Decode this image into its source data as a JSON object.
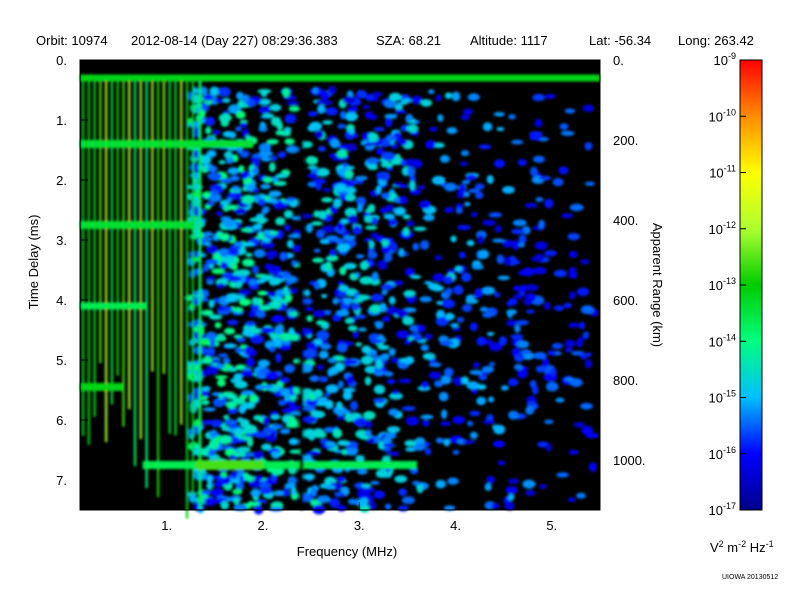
{
  "header": {
    "orbit": "Orbit: 10974",
    "datetime": "2012-08-14 (Day 227) 08:29:36.383",
    "sza": "SZA:  68.21",
    "altitude": "Altitude:     1117",
    "lat": "Lat: -56.34",
    "long": "Long: 263.42"
  },
  "credit": "UIOWA 20130512",
  "chart_data": {
    "type": "heatmap",
    "x": {
      "label": "Frequency (MHz)",
      "range": [
        0.1,
        5.5
      ],
      "ticks": [
        1,
        2,
        3,
        4,
        5
      ],
      "tick_labels": [
        "1.",
        "2.",
        "3.",
        "4.",
        "5."
      ]
    },
    "y_left": {
      "label": "Time Delay (ms)",
      "range": [
        0,
        7.5
      ],
      "inverted": true,
      "ticks": [
        0,
        1,
        2,
        3,
        4,
        5,
        6,
        7
      ],
      "tick_labels": [
        "0.",
        "1.",
        "2.",
        "3.",
        "4.",
        "5.",
        "6.",
        "7."
      ]
    },
    "y_right": {
      "label": "Apparent Range (km)",
      "range": [
        0,
        1125
      ],
      "ticks": [
        0,
        200,
        400,
        600,
        800,
        1000
      ],
      "tick_labels": [
        "0.",
        "200.",
        "400.",
        "600.",
        "800.",
        "1000."
      ]
    },
    "colorbar": {
      "scale": "log",
      "range_exponents": [
        -17,
        -9
      ],
      "exponents": [
        "-9",
        "-10",
        "-11",
        "-12",
        "-13",
        "-14",
        "-15",
        "-16",
        "-17"
      ],
      "tick_base": "10",
      "unit": {
        "v": "V",
        "v_exp": "2",
        "m": " m",
        "m_exp": "-2",
        "hz": " Hz",
        "hz_exp": "-1"
      },
      "colors": [
        "#00008b",
        "#0000ff",
        "#00bfff",
        "#00ff7f",
        "#00cc00",
        "#adff2f",
        "#ffff00",
        "#ff8c00",
        "#ff0000"
      ]
    },
    "features": [
      {
        "name": "surface-echo",
        "delay_ms": 6.75,
        "freq_mhz": [
          0.75,
          3.6
        ]
      },
      {
        "name": "local-plasma-line",
        "delay_ms": 0.3,
        "freq_mhz": [
          0.1,
          5.5
        ]
      },
      {
        "name": "harmonic-echo-1",
        "delay_ms": 1.4,
        "freq_mhz": [
          0.1,
          1.9
        ]
      },
      {
        "name": "harmonic-echo-2",
        "delay_ms": 2.75,
        "freq_mhz": [
          0.1,
          1.3
        ]
      },
      {
        "name": "harmonic-echo-3",
        "delay_ms": 4.1,
        "freq_mhz": [
          0.1,
          0.8
        ]
      },
      {
        "name": "harmonic-echo-4",
        "delay_ms": 5.45,
        "freq_mhz": [
          0.1,
          0.55
        ]
      },
      {
        "name": "gap-line",
        "freq_mhz": 2.4
      }
    ]
  }
}
